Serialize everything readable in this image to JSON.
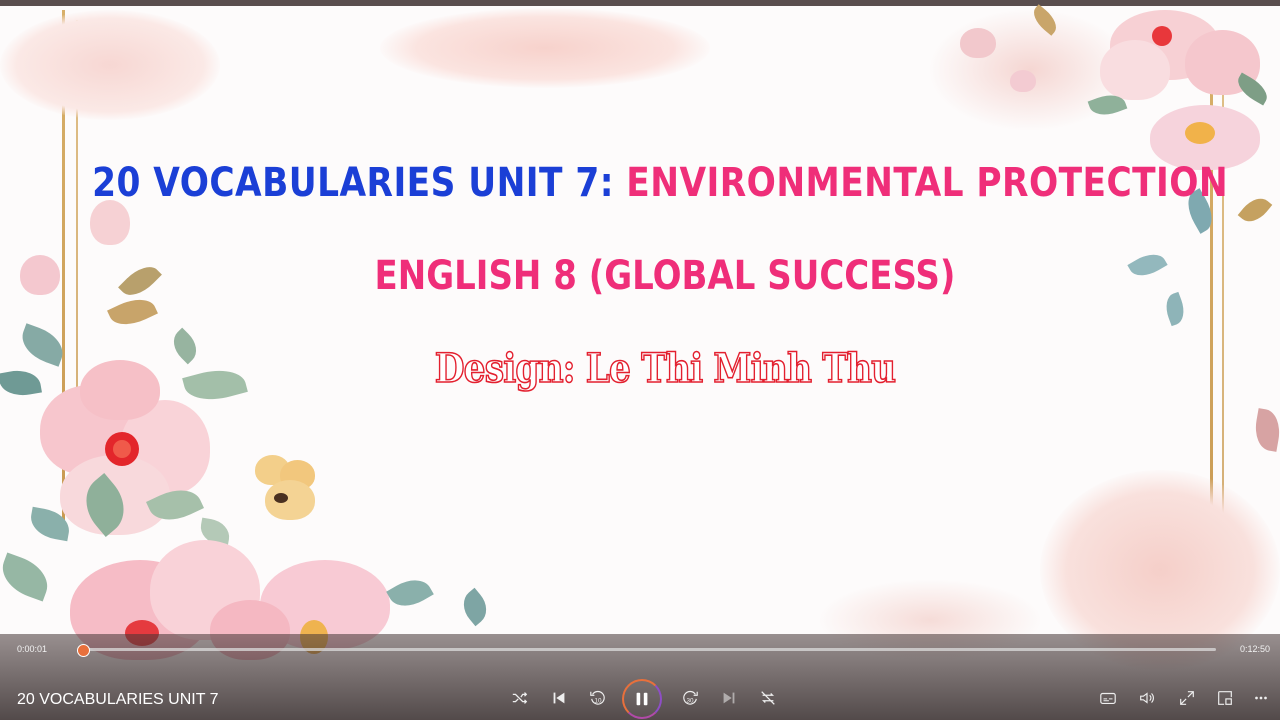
{
  "slide": {
    "title_part1": "20 VOCABULARIES UNIT 7:",
    "title_part2": "ENVIRONMENTAL PROTECTION",
    "subtitle": "ENGLISH 8 (GLOBAL SUCCESS)",
    "credit": "Design: Le Thi Minh Thu"
  },
  "player": {
    "now_playing": "20 VOCABULARIES UNIT 7",
    "current_time": "0:00:01",
    "total_time": "0:12:50",
    "progress_percent": 0.5,
    "accent_color": "#e8703c"
  },
  "controls": {
    "shuffle": "shuffle-icon",
    "previous": "previous-icon",
    "skip_back": "skip-back-10-icon",
    "skip_back_label": "10",
    "play_pause": "pause-icon",
    "skip_forward": "skip-forward-30-icon",
    "skip_forward_label": "30",
    "next": "next-icon",
    "repeat": "repeat-off-icon",
    "captions": "captions-icon",
    "volume": "volume-icon",
    "fullscreen": "fullscreen-icon",
    "mini_player": "mini-player-icon",
    "more": "more-options-icon"
  }
}
